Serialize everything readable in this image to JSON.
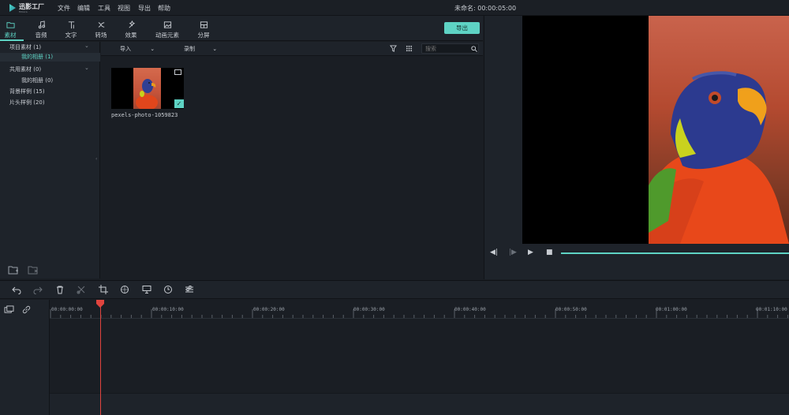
{
  "app": {
    "logo_text": "迅影工厂",
    "logo_sub": "filmora",
    "menu": [
      "文件",
      "编辑",
      "工具",
      "视图",
      "导出",
      "帮助"
    ],
    "project_title": "未命名: 00:00:05:00"
  },
  "tabs": [
    {
      "label": "素材",
      "icon": "folder-icon",
      "active": true
    },
    {
      "label": "音频",
      "icon": "music-note-icon",
      "active": false
    },
    {
      "label": "文字",
      "icon": "text-icon",
      "active": false
    },
    {
      "label": "转场",
      "icon": "transition-icon",
      "active": false
    },
    {
      "label": "效果",
      "icon": "effects-icon",
      "active": false
    },
    {
      "label": "动画元素",
      "icon": "image-element-icon",
      "active": false
    },
    {
      "label": "分屏",
      "icon": "split-screen-icon",
      "active": false
    }
  ],
  "export_label": "导出",
  "library": {
    "items": [
      {
        "label": "项目素材 (1)",
        "expandable": true
      },
      {
        "label": "我的相册 (1)",
        "selected": true
      },
      {
        "label": "共用素材 (0)",
        "expandable": true
      },
      {
        "label": "我的相册 (0)"
      },
      {
        "label": "背景样例 (15)"
      },
      {
        "label": "片头样例 (20)"
      }
    ]
  },
  "media_toolbar": {
    "import_label": "导入",
    "record_label": "录制",
    "search_placeholder": "搜索"
  },
  "media": {
    "items": [
      {
        "name": "pexels-photo-1059823",
        "selected": true
      }
    ]
  },
  "timeline": {
    "timecodes": [
      "00:00:00:00",
      "00:00:10:00",
      "00:00:20:00",
      "00:00:30:00",
      "00:00:40:00",
      "00:00:50:00",
      "00:01:00:00",
      "00:01:10:00"
    ]
  },
  "colors": {
    "accent": "#5ed3c4",
    "playhead": "#e0443e",
    "background": "#1a1e24"
  }
}
